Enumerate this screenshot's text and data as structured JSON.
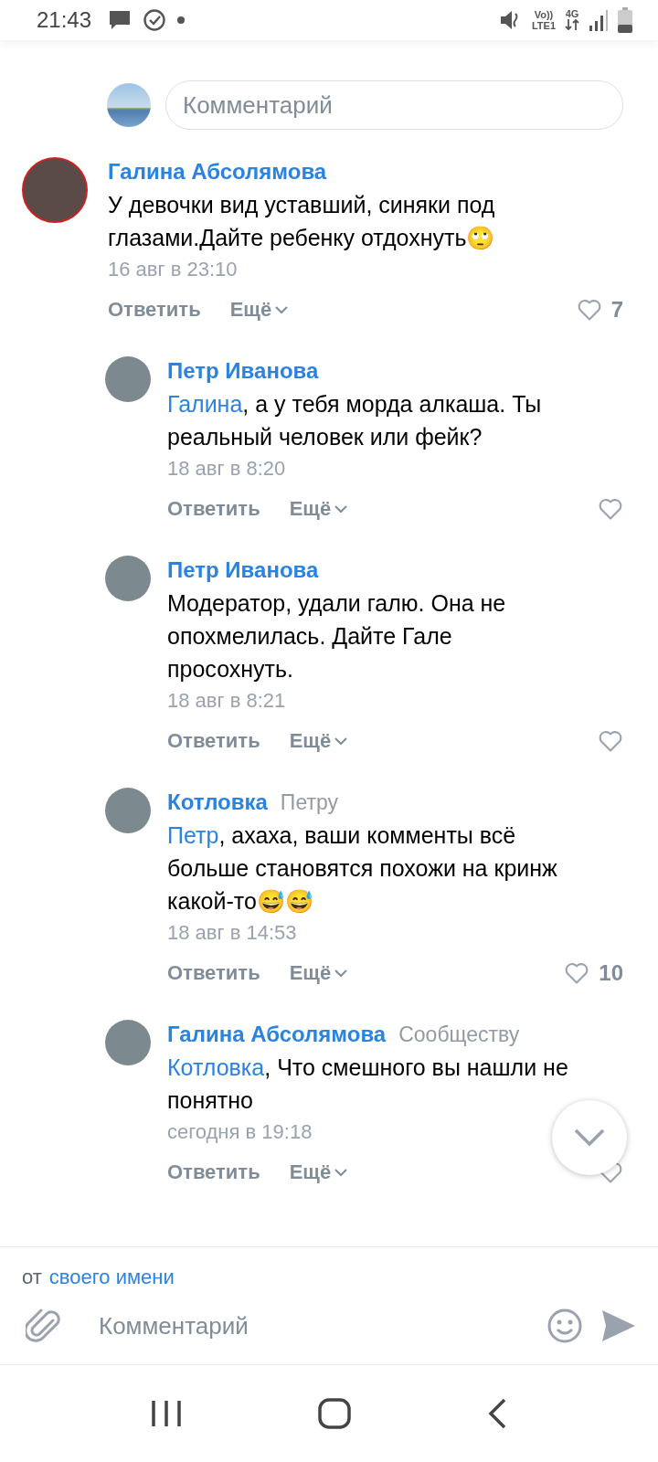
{
  "status_bar": {
    "time": "21:43",
    "volte": "Vo))",
    "lte": "LTE1",
    "network": "4G"
  },
  "reply_box": {
    "placeholder": "Комментарий"
  },
  "comments": [
    {
      "reply": false,
      "author": "Галина Абсолямова",
      "text": "У девочки вид уставший, синяки под глазами.Дайте ребенку отдохнуть🙄",
      "date": "16 авг в 23:10",
      "reply_label": "Ответить",
      "more_label": "Ещё",
      "likes": "7"
    },
    {
      "reply": true,
      "author": "Петр Иванова",
      "mention": "Галина",
      "text": ", а у тебя морда алкаша. Ты реальный человек или фейк?",
      "date": "18 авг в 8:20",
      "reply_label": "Ответить",
      "more_label": "Ещё"
    },
    {
      "reply": true,
      "author": "Петр Иванова",
      "text": "Модератор, удали галю. Она не опохмелилась. Дайте Гале просохнуть.",
      "date": "18 авг в 8:21",
      "reply_label": "Ответить",
      "more_label": "Ещё"
    },
    {
      "reply": true,
      "author": "Котловка",
      "addressee": "Петру",
      "mention": "Петр",
      "text": ", ахаха, ваши комменты всё больше становятся похожи на кринж какой-то😅😅",
      "date": "18 авг в 14:53",
      "reply_label": "Ответить",
      "more_label": "Ещё",
      "likes": "10"
    },
    {
      "reply": true,
      "author": "Галина Абсолямова",
      "addressee": "Сообществу",
      "mention": "Котловка",
      "text": ", Что смешного вы нашли не понятно",
      "date": "сегодня в 19:18",
      "reply_label": "Ответить",
      "more_label": "Ещё"
    }
  ],
  "identity": {
    "prefix": "от",
    "link": "своего имени"
  },
  "composer": {
    "placeholder": "Комментарий"
  }
}
